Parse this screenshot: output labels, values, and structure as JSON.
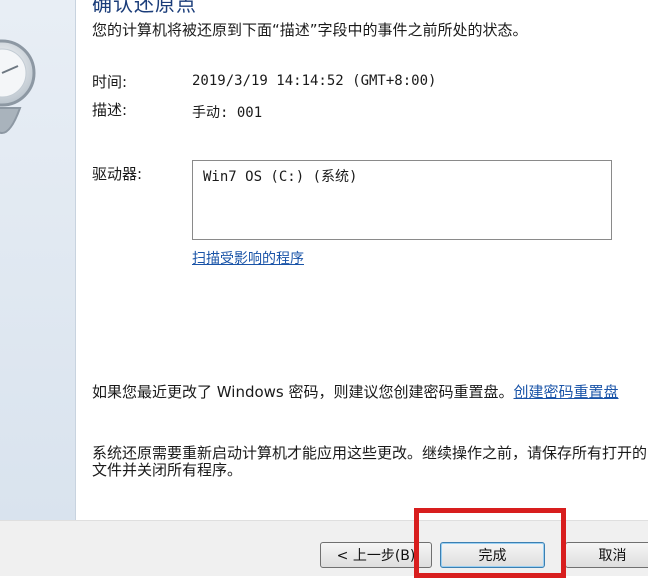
{
  "dialog": {
    "heading": "确认还原点",
    "intro": "您的计算机将被还原到下面“描述”字段中的事件之前所处的状态。"
  },
  "fields": {
    "time_label": "时间:",
    "time_value": "2019/3/19 14:14:52 (GMT+8:00)",
    "description_label": "描述:",
    "description_value": "手动: 001",
    "drives_label": "驱动器:",
    "drives": [
      "Win7 OS (C:) (系统)"
    ]
  },
  "links": {
    "scan_programs": "扫描受影响的程序",
    "create_reset_disk": "创建密码重置盘"
  },
  "notes": {
    "password_note": "如果您最近更改了 Windows 密码，则建议您创建密码重置盘。",
    "restart_note": "系统还原需要重新启动计算机才能应用这些更改。继续操作之前，请保存所有打开的文件并关闭所有程序。"
  },
  "buttons": {
    "back": "< 上一步(B)",
    "finish": "完成",
    "cancel": "取消"
  },
  "colors": {
    "heading": "#1b3d7a",
    "link": "#1a54a8",
    "highlight": "#d81e1e"
  },
  "icons": {
    "clock": "system-restore-clock-icon"
  }
}
